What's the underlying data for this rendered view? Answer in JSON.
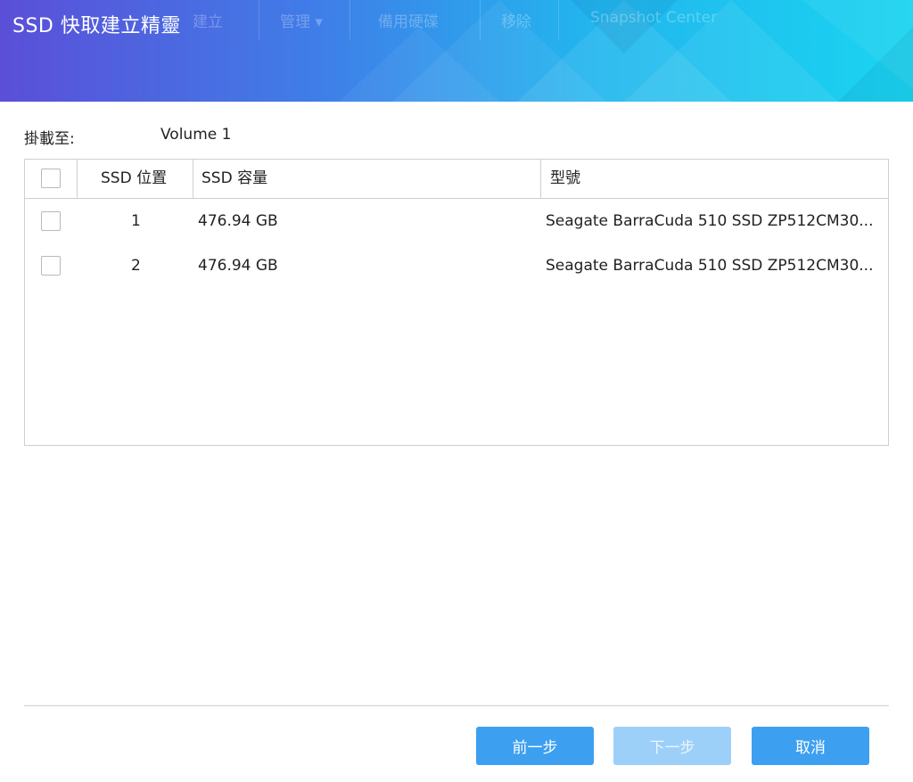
{
  "header": {
    "title": "SSD 快取建立精靈",
    "ghost_toolbar": [
      "建立",
      "管理 ▾",
      "備用硬碟",
      "移除",
      "Snapshot Center"
    ]
  },
  "mount": {
    "label": "掛載至:",
    "value": "Volume 1"
  },
  "table": {
    "columns": [
      "SSD 位置",
      "SSD 容量",
      "型號"
    ],
    "rows": [
      {
        "position": "1",
        "capacity": "476.94 GB",
        "model": "Seagate BarraCuda 510 SSD ZP512CM30..."
      },
      {
        "position": "2",
        "capacity": "476.94 GB",
        "model": "Seagate BarraCuda 510 SSD ZP512CM30..."
      }
    ]
  },
  "buttons": {
    "back": "前一步",
    "next": "下一步",
    "cancel": "取消"
  },
  "colors": {
    "button_primary": "#3d9ff0",
    "button_disabled": "#9dd0f8",
    "header_gradient_start": "#5b4fd8",
    "header_gradient_end": "#1ad4f0"
  }
}
